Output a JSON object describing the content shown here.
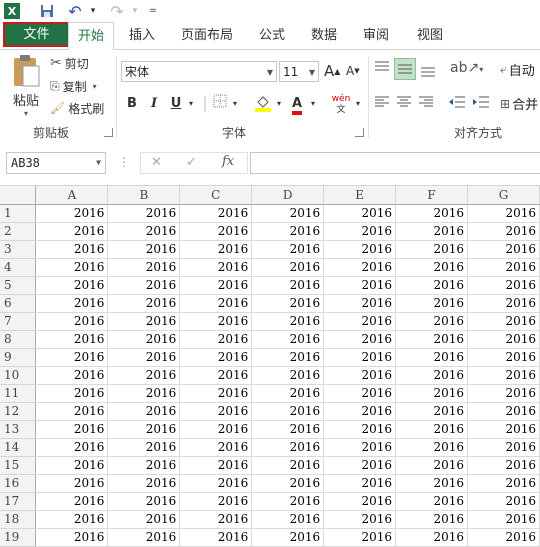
{
  "colors": {
    "accent": "#217346",
    "file_tab": "#217346",
    "highlight_border": "#d01818"
  },
  "qat": {
    "items": [
      {
        "name": "excel-logo-icon",
        "glyph": "X"
      },
      {
        "name": "save-icon",
        "glyph": "💾"
      },
      {
        "name": "undo-icon",
        "glyph": "↶"
      },
      {
        "name": "redo-icon",
        "glyph": "↷"
      },
      {
        "name": "customize-icon",
        "glyph": "="
      }
    ]
  },
  "tabs": {
    "file": "文件",
    "home": "开始",
    "insert": "插入",
    "layout": "页面布局",
    "formulas": "公式",
    "data": "数据",
    "review": "审阅",
    "view": "视图"
  },
  "ribbon": {
    "clipboard": {
      "paste": "粘贴",
      "cut": "剪切",
      "copy": "复制",
      "format_painter": "格式刷",
      "label": "剪贴板"
    },
    "font": {
      "name": "宋体",
      "size": "11",
      "grow": "A",
      "shrink": "A",
      "bold": "B",
      "italic": "I",
      "underline": "U",
      "color_letter": "A",
      "phonetic": "wén",
      "label": "字体"
    },
    "alignment": {
      "wrap": "自动",
      "merge": "合并",
      "label": "对齐方式"
    }
  },
  "formula_bar": {
    "name_box": "AB38",
    "fx": "fx",
    "cancel": "✕",
    "enter": "✓"
  },
  "grid": {
    "columns": [
      "A",
      "B",
      "C",
      "D",
      "E",
      "F",
      "G"
    ],
    "rows": [
      "1",
      "2",
      "3",
      "4",
      "5",
      "6",
      "7",
      "8",
      "9",
      "10",
      "11",
      "12",
      "13",
      "14",
      "15",
      "16",
      "17",
      "18",
      "19"
    ],
    "value": "2016"
  }
}
